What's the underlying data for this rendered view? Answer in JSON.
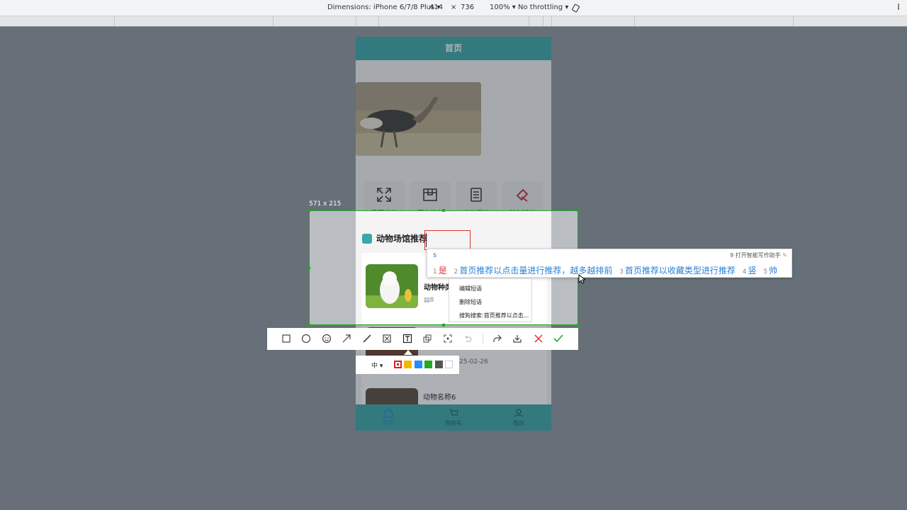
{
  "devtools": {
    "dimensions_label": "Dimensions: iPhone 6/7/8 Plus",
    "width": "414",
    "times": "×",
    "height": "736",
    "zoom": "100%",
    "throttle": "No throttling",
    "more_icon": "⋮"
  },
  "app": {
    "header_title": "首页",
    "categories": [
      {
        "label": "景区信息",
        "icon": "expand-icon"
      },
      {
        "label": "园内美食",
        "icon": "box-icon"
      },
      {
        "label": "动物场馆",
        "icon": "document-icon"
      },
      {
        "label": "特色活动",
        "icon": "hammer-icon"
      }
    ],
    "section_title": "动物场馆推荐",
    "card1": {
      "title": "动物种类",
      "count": "8"
    },
    "card2": {
      "date": "25-02-26"
    },
    "card3": {
      "title": "动物名称6"
    },
    "tabs": [
      {
        "label": "首页",
        "icon": "home-icon"
      },
      {
        "label": "购物车",
        "icon": "cart-icon"
      },
      {
        "label": "我的",
        "icon": "user-icon"
      }
    ]
  },
  "screenshot": {
    "size_label": "571 x 215"
  },
  "ime": {
    "input": "s",
    "assistant": "9 打开智能写作助手",
    "candidates": [
      {
        "num": "1",
        "text": "是"
      },
      {
        "num": "2",
        "text": "首页推荐以点击量进行推荐，越多越排前"
      },
      {
        "num": "3",
        "text": "首页推荐以收藏类型进行推荐"
      },
      {
        "num": "4",
        "text": "竖"
      },
      {
        "num": "5",
        "text": "帅"
      }
    ],
    "next": "›"
  },
  "context_menu": {
    "edit": "编辑短语",
    "delete": "删除短语",
    "search": "搜狗搜索:首页推荐以点击..."
  },
  "toolbar": {
    "tools": [
      "rectangle-icon",
      "ellipse-icon",
      "emoji-icon",
      "arrow-icon",
      "pen-icon",
      "mosaic-icon",
      "text-icon",
      "copy-icon",
      "ocr-icon",
      "undo-icon",
      "share-icon",
      "save-icon",
      "cancel-icon",
      "confirm-icon"
    ],
    "size_label": "中",
    "colors": [
      "#e02020",
      "#f5b800",
      "#1e90ff",
      "#22aa22",
      "#555555",
      "#ffffff"
    ]
  }
}
